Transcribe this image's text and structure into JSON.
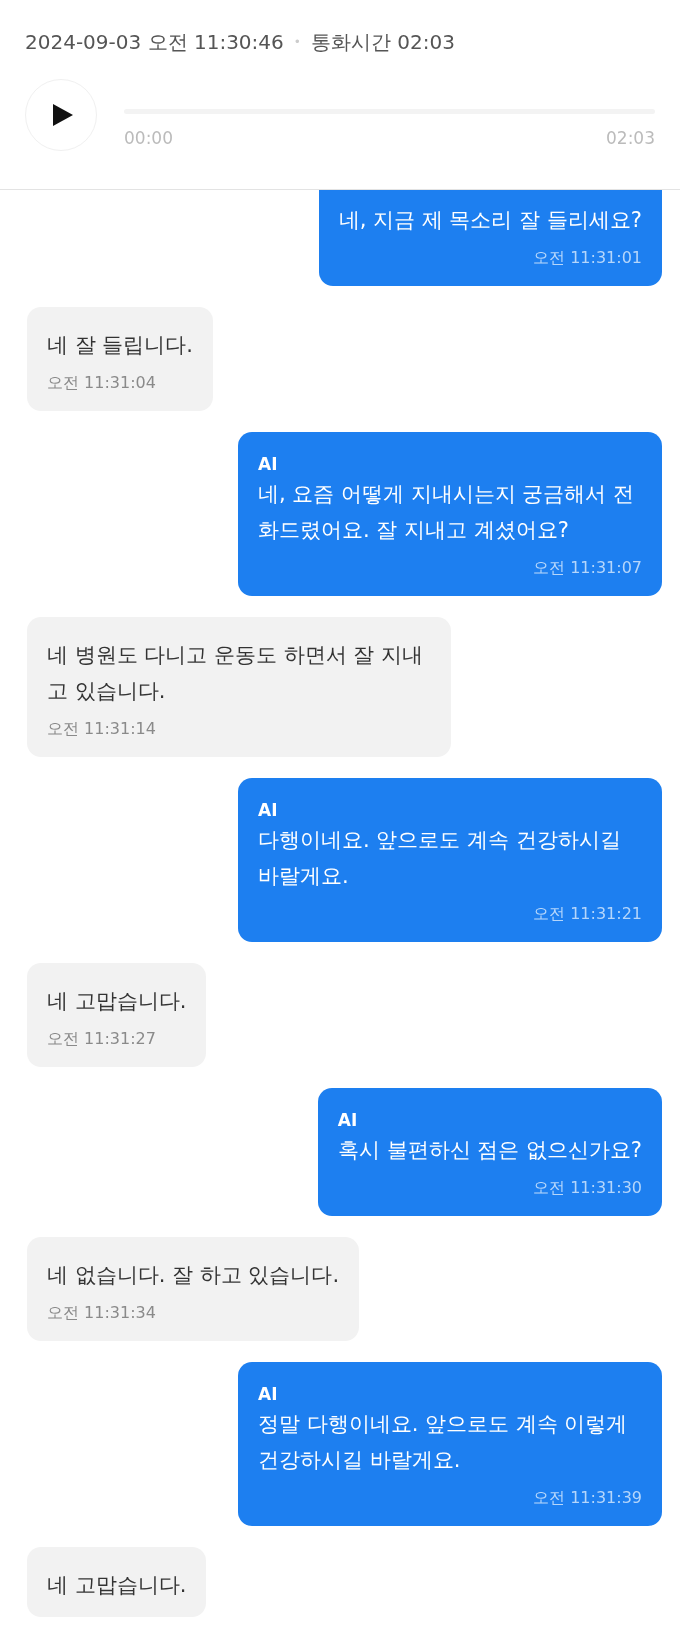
{
  "header": {
    "datetime": "2024-09-03 오전 11:30:46",
    "separator": "•",
    "duration": "통화시간 02:03"
  },
  "player": {
    "playing": false,
    "start_time": "00:00",
    "end_time": "02:03"
  },
  "messages": [
    {
      "kind": "ai",
      "text": "네, 지금 제 목소리 잘 들리세요?",
      "time": "오전 11:31:01"
    },
    {
      "kind": "user",
      "text": "네 잘 들립니다.",
      "time": "오전 11:31:04"
    },
    {
      "kind": "ai",
      "label": "AI",
      "text": "네, 요즘 어떻게 지내시는지 궁금해서 전화드렸어요. 잘 지내고 계셨어요?",
      "time": "오전 11:31:07"
    },
    {
      "kind": "user",
      "text": "네 병원도 다니고 운동도 하면서 잘 지내고 있습니다.",
      "time": "오전 11:31:14"
    },
    {
      "kind": "ai",
      "label": "AI",
      "text": "다행이네요. 앞으로도 계속 건강하시길 바랄게요.",
      "time": "오전 11:31:21"
    },
    {
      "kind": "user",
      "text": "네 고맙습니다.",
      "time": "오전 11:31:27"
    },
    {
      "kind": "ai",
      "label": "AI",
      "text": "혹시 불편하신 점은 없으신가요?",
      "time": "오전 11:31:30"
    },
    {
      "kind": "user",
      "text": "네 없습니다. 잘 하고 있습니다.",
      "time": "오전 11:31:34"
    },
    {
      "kind": "ai",
      "label": "AI",
      "text": "정말 다행이네요. 앞으로도 계속 이렇게 건강하시길 바랄게요.",
      "time": "오전 11:31:39"
    },
    {
      "kind": "user",
      "text": "네 고맙습니다."
    }
  ]
}
